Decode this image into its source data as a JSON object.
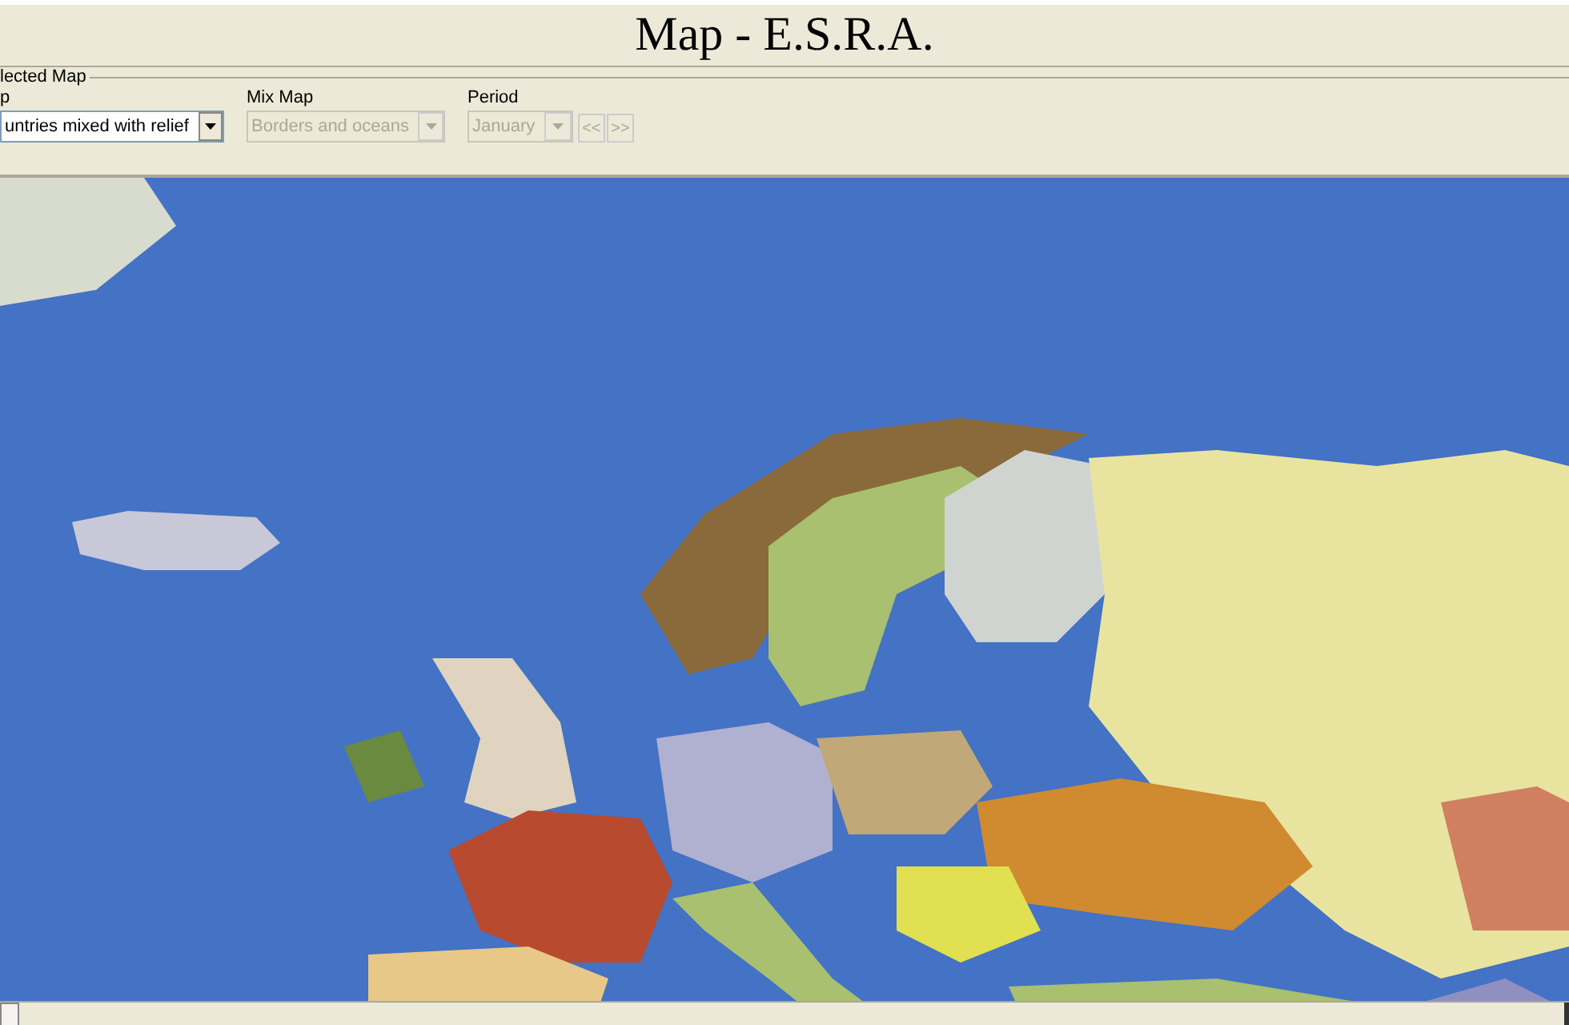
{
  "window": {
    "title": "Map - E.S.R.A."
  },
  "selected_map": {
    "legend": "lected Map",
    "fields": [
      {
        "label": "p",
        "value": "untries mixed with relief",
        "disabled": false
      },
      {
        "label": "Mix Map",
        "value": "Borders and oceans",
        "disabled": true
      },
      {
        "label": "Period",
        "value": "January",
        "disabled": true
      }
    ],
    "buttons": [
      {
        "label": "<<",
        "disabled": true
      },
      {
        "label": ">>",
        "disabled": true
      }
    ]
  }
}
